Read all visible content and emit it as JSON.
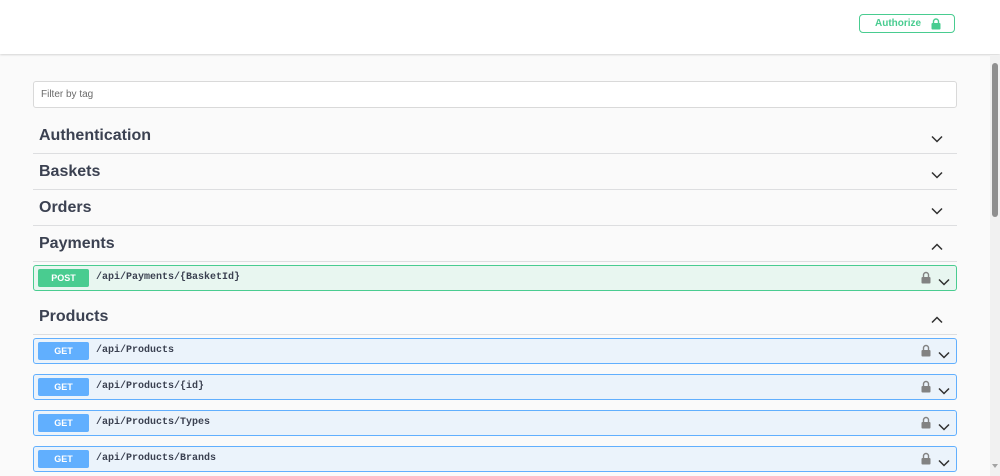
{
  "header": {
    "authorize_label": "Authorize"
  },
  "filter": {
    "placeholder": "Filter by tag"
  },
  "tags": [
    {
      "name": "Authentication",
      "expanded": false
    },
    {
      "name": "Baskets",
      "expanded": false
    },
    {
      "name": "Orders",
      "expanded": false
    },
    {
      "name": "Payments",
      "expanded": true
    },
    {
      "name": "Products",
      "expanded": true
    }
  ],
  "operations": [
    {
      "method": "POST",
      "path": "/api/Payments/{BasketId}"
    },
    {
      "method": "GET",
      "path": "/api/Products"
    },
    {
      "method": "GET",
      "path": "/api/Products/{id}"
    },
    {
      "method": "GET",
      "path": "/api/Products/Types"
    },
    {
      "method": "GET",
      "path": "/api/Products/Brands"
    }
  ],
  "colors": {
    "post": "#49cc90",
    "get": "#61affe",
    "text": "#3b4151"
  },
  "icons": {
    "lock": "lock-icon",
    "chevron_down": "chevron-down-icon",
    "chevron_up": "chevron-up-icon"
  }
}
